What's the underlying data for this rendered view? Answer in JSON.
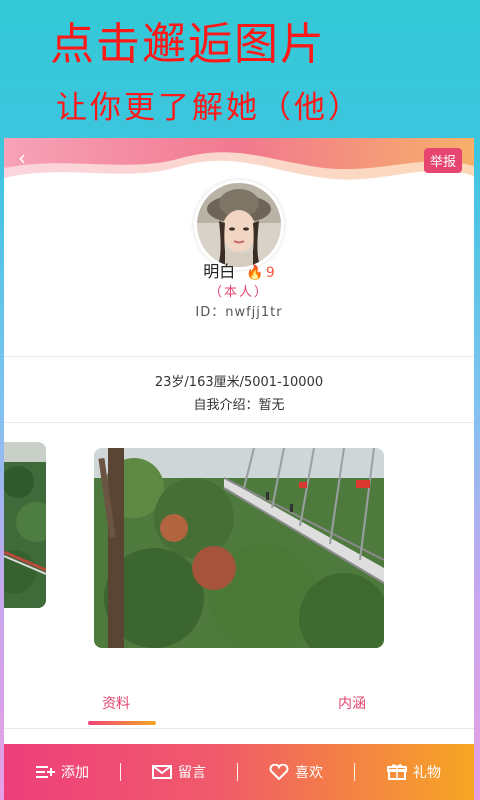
{
  "promo": {
    "title": "点击邂逅图片",
    "subtitle": "让你更了解她（他）"
  },
  "header": {
    "report_label": "举报",
    "back_icon": "back-arrow-icon"
  },
  "profile": {
    "name": "明白",
    "heat_count": "9",
    "self_tag": "（本人）",
    "id_text": "ID：nwfjj1tr",
    "stats": "23岁/163厘米/5001-10000",
    "bio": "自我介绍：暂无"
  },
  "tabs": [
    {
      "label": "资料"
    },
    {
      "label": "内涵"
    }
  ],
  "actions": [
    {
      "label": "添加",
      "icon": "add-friend-icon"
    },
    {
      "label": "留言",
      "icon": "mail-icon"
    },
    {
      "label": "喜欢",
      "icon": "heart-icon"
    },
    {
      "label": "礼物",
      "icon": "gift-icon"
    }
  ],
  "colors": {
    "accent": "#e5456f",
    "promo_text": "#ff1818",
    "gradient_start": "#ee3f7c",
    "gradient_end": "#f7a623"
  }
}
